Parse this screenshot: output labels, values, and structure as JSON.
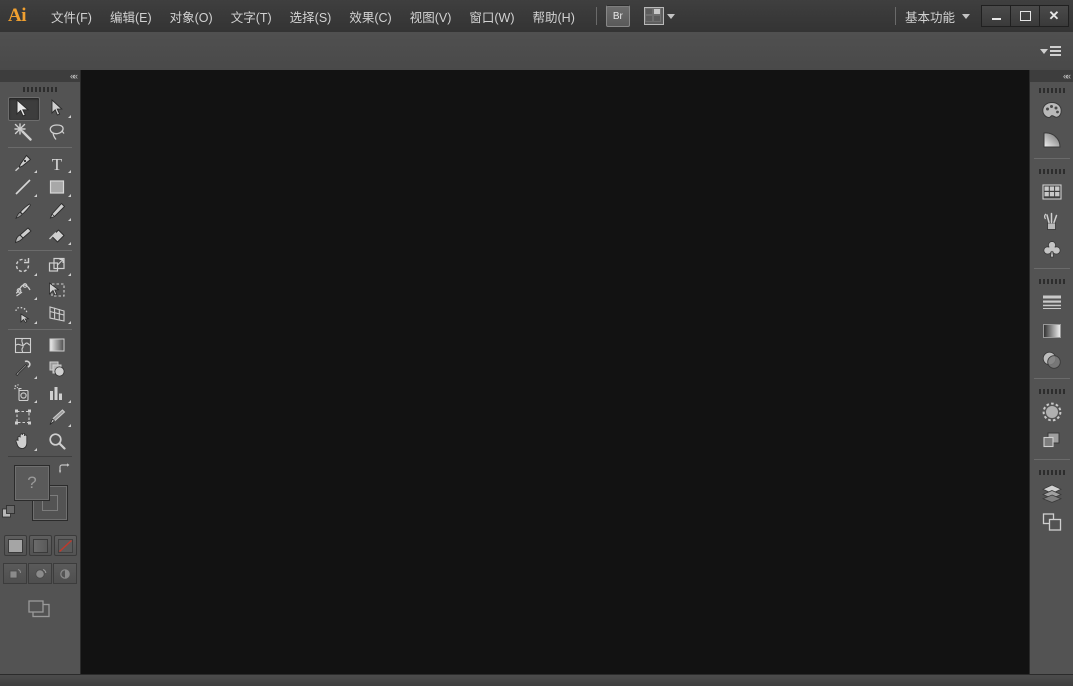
{
  "app": {
    "name": "Adobe Illustrator",
    "logo_text": "Ai",
    "logo_color": "#f0a030"
  },
  "menubar": {
    "items": [
      {
        "label": "文件(F)",
        "name": "menu-file"
      },
      {
        "label": "编辑(E)",
        "name": "menu-edit"
      },
      {
        "label": "对象(O)",
        "name": "menu-object"
      },
      {
        "label": "文字(T)",
        "name": "menu-type"
      },
      {
        "label": "选择(S)",
        "name": "menu-select"
      },
      {
        "label": "效果(C)",
        "name": "menu-effect"
      },
      {
        "label": "视图(V)",
        "name": "menu-view"
      },
      {
        "label": "窗口(W)",
        "name": "menu-window"
      },
      {
        "label": "帮助(H)",
        "name": "menu-help"
      }
    ],
    "bridge_button_label": "Br",
    "arrange_documents_label": "排列文档"
  },
  "titlebar": {
    "workspace_name": "基本功能",
    "workspace_caret": "▾",
    "window_controls": {
      "minimize": "—",
      "maximize": "▢",
      "close": "✕"
    }
  },
  "controlbar": {
    "panel_menu_label": "面板菜单"
  },
  "toolbar": {
    "collapse_label": "««",
    "tools": [
      {
        "name": "selection-tool",
        "label": "选择工具",
        "active": true,
        "has_flyout": false
      },
      {
        "name": "direct-selection-tool",
        "label": "直接选择工具",
        "active": false,
        "has_flyout": true
      },
      {
        "name": "magic-wand-tool",
        "label": "魔棒工具",
        "active": false,
        "has_flyout": false
      },
      {
        "name": "lasso-tool",
        "label": "套索工具",
        "active": false,
        "has_flyout": false
      },
      {
        "name": "pen-tool",
        "label": "钢笔工具",
        "active": false,
        "has_flyout": true
      },
      {
        "name": "type-tool",
        "label": "文字工具",
        "active": false,
        "has_flyout": true
      },
      {
        "name": "line-segment-tool",
        "label": "直线段工具",
        "active": false,
        "has_flyout": true
      },
      {
        "name": "rectangle-tool",
        "label": "矩形工具",
        "active": false,
        "has_flyout": true
      },
      {
        "name": "paintbrush-tool",
        "label": "画笔工具",
        "active": false,
        "has_flyout": false
      },
      {
        "name": "pencil-tool",
        "label": "铅笔工具",
        "active": false,
        "has_flyout": true
      },
      {
        "name": "blob-brush-tool",
        "label": "斑点画笔工具",
        "active": false,
        "has_flyout": false
      },
      {
        "name": "eraser-tool",
        "label": "橡皮擦工具",
        "active": false,
        "has_flyout": true
      },
      {
        "name": "rotate-tool",
        "label": "旋转工具",
        "active": false,
        "has_flyout": true
      },
      {
        "name": "scale-tool",
        "label": "比例缩放工具",
        "active": false,
        "has_flyout": true
      },
      {
        "name": "width-tool",
        "label": "宽度工具",
        "active": false,
        "has_flyout": true
      },
      {
        "name": "free-transform-tool",
        "label": "自由变换工具",
        "active": false,
        "has_flyout": false
      },
      {
        "name": "shape-builder-tool",
        "label": "形状生成器工具",
        "active": false,
        "has_flyout": true
      },
      {
        "name": "perspective-grid-tool",
        "label": "透视网格工具",
        "active": false,
        "has_flyout": true
      },
      {
        "name": "mesh-tool",
        "label": "网格工具",
        "active": false,
        "has_flyout": false
      },
      {
        "name": "gradient-tool",
        "label": "渐变工具",
        "active": false,
        "has_flyout": false
      },
      {
        "name": "eyedropper-tool",
        "label": "吸管工具",
        "active": false,
        "has_flyout": true
      },
      {
        "name": "blend-tool",
        "label": "混合工具",
        "active": false,
        "has_flyout": false
      },
      {
        "name": "symbol-sprayer-tool",
        "label": "符号喷枪工具",
        "active": false,
        "has_flyout": true
      },
      {
        "name": "column-graph-tool",
        "label": "柱形图工具",
        "active": false,
        "has_flyout": true
      },
      {
        "name": "artboard-tool",
        "label": "画板工具",
        "active": false,
        "has_flyout": false
      },
      {
        "name": "slice-tool",
        "label": "切片工具",
        "active": false,
        "has_flyout": true
      },
      {
        "name": "hand-tool",
        "label": "抓手工具",
        "active": false,
        "has_flyout": true
      },
      {
        "name": "zoom-tool",
        "label": "缩放工具",
        "active": false,
        "has_flyout": false
      }
    ],
    "fill_stroke": {
      "fill_label": "填色",
      "fill_indicator": "?",
      "stroke_label": "描边",
      "swap_label": "互换填色和描边",
      "default_label": "默认填色和描边"
    },
    "color_modes": [
      {
        "name": "color-mode-button",
        "label": "颜色"
      },
      {
        "name": "gradient-mode-button",
        "label": "渐变"
      },
      {
        "name": "none-mode-button",
        "label": "无"
      }
    ],
    "drawing_modes": [
      {
        "name": "draw-normal-button",
        "label": "正常绘图"
      },
      {
        "name": "draw-behind-button",
        "label": "背面绘图"
      },
      {
        "name": "draw-inside-button",
        "label": "内部绘图"
      }
    ],
    "screen_mode": {
      "name": "screen-mode-button",
      "label": "更改屏幕模式"
    }
  },
  "right_dock": {
    "collapse_label": "««",
    "groups": [
      {
        "name": "dock-group-color",
        "items": [
          {
            "name": "panel-icon-color",
            "label": "颜色"
          },
          {
            "name": "panel-icon-gradient",
            "label": "渐变"
          }
        ]
      },
      {
        "name": "dock-group-swatches",
        "items": [
          {
            "name": "panel-icon-swatches",
            "label": "色板"
          },
          {
            "name": "panel-icon-brushes",
            "label": "画笔"
          },
          {
            "name": "panel-icon-symbols",
            "label": "符号"
          }
        ]
      },
      {
        "name": "dock-group-stroke",
        "items": [
          {
            "name": "panel-icon-stroke",
            "label": "描边"
          },
          {
            "name": "panel-icon-gradient-2",
            "label": "渐变"
          },
          {
            "name": "panel-icon-transparency",
            "label": "透明度"
          }
        ]
      },
      {
        "name": "dock-group-appearance",
        "items": [
          {
            "name": "panel-icon-appearance",
            "label": "外观"
          },
          {
            "name": "panel-icon-graphic-styles",
            "label": "图形样式"
          }
        ]
      },
      {
        "name": "dock-group-layers",
        "items": [
          {
            "name": "panel-icon-layers",
            "label": "图层"
          },
          {
            "name": "panel-icon-artboards",
            "label": "画板"
          }
        ]
      }
    ]
  },
  "canvas": {
    "background_color": "#121212",
    "document_open": false
  },
  "theme": {
    "chrome_color": "#535353",
    "titlebar_color": "#393939",
    "control_bar_color": "#4d4d4d",
    "icon_color": "#c9c9c9"
  }
}
